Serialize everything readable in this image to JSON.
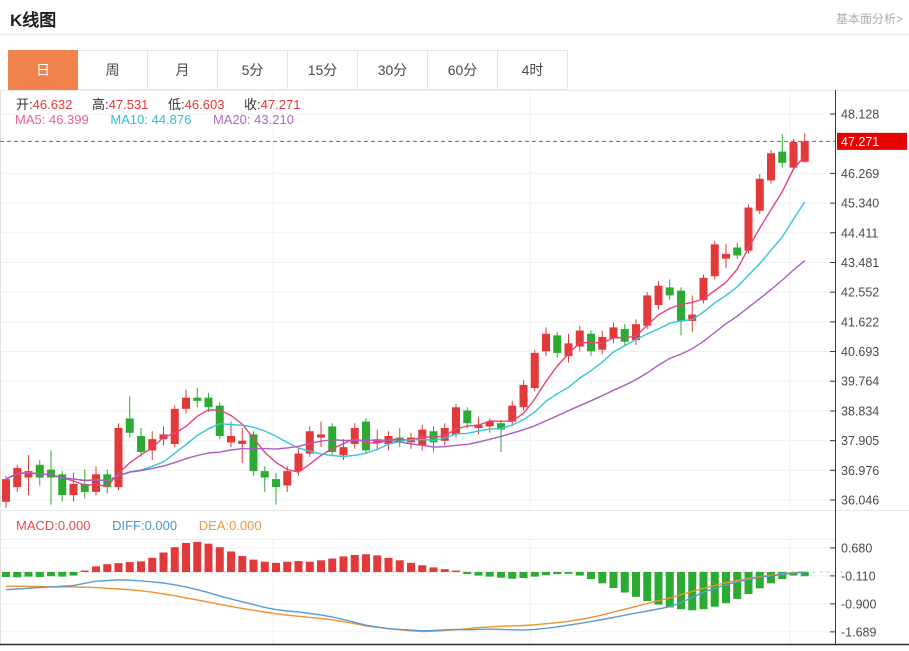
{
  "header": {
    "title": "K线图",
    "link": "基本面分析>"
  },
  "tabs": [
    {
      "name": "day",
      "label": "日",
      "active": true
    },
    {
      "name": "week",
      "label": "周",
      "active": false
    },
    {
      "name": "month",
      "label": "月",
      "active": false
    },
    {
      "name": "5min",
      "label": "5分",
      "active": false
    },
    {
      "name": "15min",
      "label": "15分",
      "active": false
    },
    {
      "name": "30min",
      "label": "30分",
      "active": false
    },
    {
      "name": "60min",
      "label": "60分",
      "active": false
    },
    {
      "name": "4hour",
      "label": "4时",
      "active": false
    }
  ],
  "info": {
    "open_label": "开:",
    "open_value": "46.632",
    "high_label": "高:",
    "high_value": "47.531",
    "low_label": "低:",
    "low_value": "46.603",
    "close_label": "收:",
    "close_value": "47.271"
  },
  "ma": {
    "ma5_label": "MA5:",
    "ma5_value": "46.399",
    "ma10_label": "MA10:",
    "ma10_value": "44.876",
    "ma20_label": "MA20:",
    "ma20_value": "43.210"
  },
  "macd_info": {
    "macd_label": "MACD:",
    "macd_value": "0.000",
    "diff_label": "DIFF:",
    "diff_value": "0.000",
    "dea_label": "DEA:",
    "dea_value": "0.000"
  },
  "colors": {
    "up": "#e23a3a",
    "down": "#2bab31",
    "ma5": "#e8437a",
    "ma10": "#36c6d9",
    "ma20": "#ab5bc2",
    "diff": "#5b9bd5",
    "dea": "#f09030",
    "price_line": "#e53935",
    "badge_bg": "#e60000",
    "grid": "#f0f0f2",
    "axis": "#3a3a3a",
    "tick_text": "#4a4a4a",
    "tab_active": "#f0834c"
  },
  "chart_data": {
    "type": "candlestick",
    "title": "K线图",
    "legend": [
      "MA5",
      "MA10",
      "MA20",
      "MACD",
      "DIFF",
      "DEA"
    ],
    "price_axis": {
      "ticks": [
        48.128,
        46.269,
        45.34,
        44.411,
        43.481,
        42.552,
        41.622,
        40.693,
        39.764,
        38.834,
        37.905,
        36.976,
        36.046
      ],
      "current_price": 47.271,
      "current_price_label": "47.271"
    },
    "macd_axis": {
      "ticks": [
        0.68,
        -0.11,
        -0.9,
        -1.689
      ]
    },
    "ma_periods": [
      5,
      10,
      20
    ],
    "candles": [
      [
        35.99,
        36.8,
        35.8,
        36.7
      ],
      [
        36.45,
        37.15,
        36.3,
        37.05
      ],
      [
        36.75,
        37.45,
        36.2,
        36.95
      ],
      [
        37.15,
        37.3,
        36.5,
        36.75
      ],
      [
        37.0,
        37.6,
        35.9,
        36.75
      ],
      [
        36.85,
        36.95,
        36.0,
        36.2
      ],
      [
        36.2,
        36.9,
        36.0,
        36.55
      ],
      [
        36.55,
        37.0,
        36.1,
        36.3
      ],
      [
        36.3,
        37.1,
        36.2,
        36.85
      ],
      [
        36.85,
        37.0,
        36.25,
        36.45
      ],
      [
        36.45,
        38.45,
        36.35,
        38.3
      ],
      [
        38.6,
        39.3,
        38.0,
        38.15
      ],
      [
        38.05,
        38.3,
        37.4,
        37.55
      ],
      [
        37.6,
        38.2,
        37.3,
        37.95
      ],
      [
        37.95,
        38.35,
        37.75,
        38.1
      ],
      [
        37.8,
        39.0,
        37.7,
        38.9
      ],
      [
        38.9,
        39.5,
        38.75,
        39.25
      ],
      [
        39.25,
        39.55,
        38.95,
        39.15
      ],
      [
        39.25,
        39.4,
        38.8,
        38.95
      ],
      [
        39.0,
        39.1,
        37.95,
        38.05
      ],
      [
        37.85,
        38.5,
        37.7,
        38.05
      ],
      [
        37.8,
        38.3,
        37.2,
        37.9
      ],
      [
        38.1,
        38.2,
        36.8,
        36.95
      ],
      [
        36.95,
        37.1,
        36.3,
        36.75
      ],
      [
        36.7,
        36.9,
        35.9,
        36.45
      ],
      [
        36.5,
        37.1,
        36.3,
        36.95
      ],
      [
        36.95,
        37.65,
        36.8,
        37.5
      ],
      [
        37.5,
        38.35,
        37.4,
        38.2
      ],
      [
        38.0,
        38.5,
        37.7,
        38.1
      ],
      [
        38.35,
        38.45,
        37.45,
        37.55
      ],
      [
        37.45,
        37.95,
        37.3,
        37.7
      ],
      [
        37.8,
        38.45,
        37.65,
        38.3
      ],
      [
        38.5,
        38.6,
        37.5,
        37.6
      ],
      [
        37.85,
        38.25,
        37.6,
        37.95
      ],
      [
        37.8,
        38.2,
        37.6,
        38.05
      ],
      [
        38.0,
        38.3,
        37.7,
        37.9
      ],
      [
        37.85,
        38.15,
        37.65,
        38.0
      ],
      [
        37.75,
        38.4,
        37.6,
        38.25
      ],
      [
        38.2,
        38.35,
        37.55,
        37.85
      ],
      [
        37.9,
        38.45,
        37.75,
        38.3
      ],
      [
        38.1,
        39.05,
        38.0,
        38.95
      ],
      [
        38.85,
        38.95,
        38.3,
        38.45
      ],
      [
        38.3,
        38.65,
        38.1,
        38.4
      ],
      [
        38.35,
        38.6,
        38.15,
        38.5
      ],
      [
        38.45,
        38.55,
        37.55,
        38.25
      ],
      [
        38.5,
        39.15,
        38.35,
        39.0
      ],
      [
        38.95,
        39.8,
        38.85,
        39.65
      ],
      [
        39.55,
        40.75,
        39.45,
        40.65
      ],
      [
        40.7,
        41.45,
        40.55,
        41.25
      ],
      [
        41.2,
        41.3,
        40.5,
        40.65
      ],
      [
        40.55,
        41.25,
        40.35,
        40.95
      ],
      [
        40.85,
        41.5,
        40.7,
        41.35
      ],
      [
        41.25,
        41.35,
        40.55,
        40.7
      ],
      [
        40.75,
        41.35,
        40.6,
        41.15
      ],
      [
        41.1,
        41.6,
        40.95,
        41.45
      ],
      [
        41.4,
        41.55,
        40.85,
        41.0
      ],
      [
        41.05,
        41.7,
        40.9,
        41.55
      ],
      [
        41.5,
        42.55,
        41.4,
        42.45
      ],
      [
        42.15,
        42.9,
        42.0,
        42.75
      ],
      [
        42.7,
        42.95,
        42.3,
        42.45
      ],
      [
        42.6,
        42.7,
        41.2,
        41.65
      ],
      [
        41.65,
        42.45,
        41.3,
        41.85
      ],
      [
        42.3,
        43.1,
        42.2,
        43.0
      ],
      [
        43.05,
        44.15,
        42.95,
        44.05
      ],
      [
        43.6,
        44.05,
        43.3,
        43.75
      ],
      [
        43.95,
        44.1,
        43.6,
        43.7
      ],
      [
        43.85,
        45.3,
        43.75,
        45.2
      ],
      [
        45.1,
        46.25,
        45.0,
        46.1
      ],
      [
        46.05,
        47.0,
        45.95,
        46.9
      ],
      [
        46.95,
        47.5,
        46.45,
        46.6
      ],
      [
        46.45,
        47.35,
        46.35,
        47.25
      ],
      [
        46.632,
        47.531,
        46.603,
        47.271
      ]
    ],
    "macd_histogram": [
      -0.14,
      -0.15,
      -0.13,
      -0.14,
      -0.12,
      -0.13,
      -0.1,
      0.04,
      0.16,
      0.22,
      0.25,
      0.28,
      0.3,
      0.4,
      0.55,
      0.7,
      0.82,
      0.85,
      0.8,
      0.7,
      0.58,
      0.45,
      0.35,
      0.29,
      0.26,
      0.29,
      0.31,
      0.29,
      0.33,
      0.38,
      0.44,
      0.48,
      0.5,
      0.47,
      0.4,
      0.33,
      0.26,
      0.19,
      0.13,
      0.08,
      0.04,
      -0.06,
      -0.1,
      -0.13,
      -0.16,
      -0.19,
      -0.17,
      -0.13,
      -0.09,
      -0.06,
      -0.05,
      -0.1,
      -0.2,
      -0.32,
      -0.45,
      -0.58,
      -0.7,
      -0.82,
      -0.92,
      -1.0,
      -1.05,
      -1.08,
      -1.05,
      -0.98,
      -0.88,
      -0.76,
      -0.62,
      -0.46,
      -0.32,
      -0.2,
      -0.1,
      -0.12
    ],
    "diff_line": [
      -0.5,
      -0.48,
      -0.46,
      -0.44,
      -0.42,
      -0.4,
      -0.38,
      -0.32,
      -0.26,
      -0.24,
      -0.22,
      -0.23,
      -0.25,
      -0.28,
      -0.31,
      -0.36,
      -0.42,
      -0.5,
      -0.58,
      -0.68,
      -0.76,
      -0.84,
      -0.92,
      -1.0,
      -1.06,
      -1.1,
      -1.13,
      -1.17,
      -1.21,
      -1.27,
      -1.34,
      -1.42,
      -1.5,
      -1.55,
      -1.6,
      -1.62,
      -1.64,
      -1.66,
      -1.65,
      -1.63,
      -1.62,
      -1.63,
      -1.62,
      -1.61,
      -1.62,
      -1.63,
      -1.64,
      -1.62,
      -1.59,
      -1.55,
      -1.5,
      -1.45,
      -1.4,
      -1.34,
      -1.28,
      -1.22,
      -1.16,
      -1.1,
      -1.04,
      -0.98,
      -0.86,
      -0.72,
      -0.57,
      -0.46,
      -0.36,
      -0.28,
      -0.21,
      -0.15,
      -0.11,
      -0.07,
      -0.03,
      -0.01
    ],
    "dea_line": [
      -0.4,
      -0.4,
      -0.41,
      -0.41,
      -0.42,
      -0.42,
      -0.42,
      -0.43,
      -0.44,
      -0.46,
      -0.48,
      -0.5,
      -0.53,
      -0.57,
      -0.62,
      -0.67,
      -0.73,
      -0.79,
      -0.85,
      -0.91,
      -0.97,
      -1.03,
      -1.08,
      -1.13,
      -1.18,
      -1.22,
      -1.25,
      -1.28,
      -1.31,
      -1.35,
      -1.4,
      -1.46,
      -1.52,
      -1.56,
      -1.6,
      -1.63,
      -1.66,
      -1.68,
      -1.67,
      -1.65,
      -1.63,
      -1.6,
      -1.57,
      -1.55,
      -1.53,
      -1.52,
      -1.51,
      -1.49,
      -1.46,
      -1.43,
      -1.39,
      -1.34,
      -1.28,
      -1.21,
      -1.13,
      -1.05,
      -0.97,
      -0.89,
      -0.81,
      -0.73,
      -0.64,
      -0.55,
      -0.46,
      -0.38,
      -0.3,
      -0.24,
      -0.18,
      -0.13,
      -0.09,
      -0.05,
      -0.02,
      0.0
    ]
  }
}
